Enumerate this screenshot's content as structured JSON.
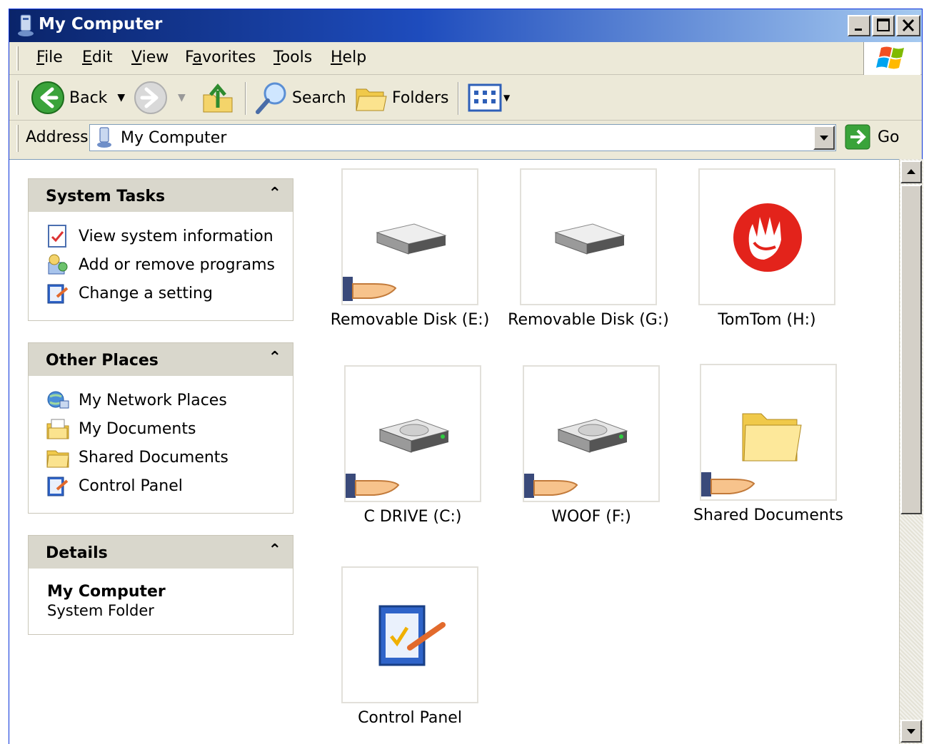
{
  "window": {
    "title": "My Computer"
  },
  "menu": {
    "items": [
      {
        "label": "File",
        "accel": "F",
        "rest": "ile"
      },
      {
        "label": "Edit",
        "accel": "E",
        "rest": "dit"
      },
      {
        "label": "View",
        "accel": "V",
        "rest": "iew"
      },
      {
        "label": "Favorites",
        "pre": "F",
        "accel": "a",
        "rest": "vorites"
      },
      {
        "label": "Tools",
        "accel": "T",
        "rest": "ools"
      },
      {
        "label": "Help",
        "accel": "H",
        "rest": "elp"
      }
    ]
  },
  "toolbar": {
    "back_label": "Back",
    "search_label": "Search",
    "folders_label": "Folders"
  },
  "address": {
    "label": "Address",
    "value": "My Computer",
    "go_label": "Go"
  },
  "panes": {
    "system_tasks": {
      "title": "System Tasks",
      "items": [
        "View system information",
        "Add or remove programs",
        "Change a setting"
      ]
    },
    "other_places": {
      "title": "Other Places",
      "items": [
        "My Network Places",
        "My Documents",
        "Shared Documents",
        "Control Panel"
      ]
    },
    "details": {
      "title": "Details",
      "name": "My Computer",
      "type": "System Folder"
    }
  },
  "items": [
    {
      "label": "Removable Disk (E:)",
      "icon": "removable-disk-icon",
      "shared": true
    },
    {
      "label": "Removable Disk (G:)",
      "icon": "removable-disk-icon",
      "shared": false
    },
    {
      "label": "TomTom (H:)",
      "icon": "tomtom-icon",
      "shared": false
    },
    {
      "label": "C DRIVE (C:)",
      "icon": "hard-drive-icon",
      "shared": true
    },
    {
      "label": "WOOF (F:)",
      "icon": "hard-drive-icon",
      "shared": true
    },
    {
      "label": "Shared Documents",
      "icon": "folder-icon",
      "shared": true
    },
    {
      "label": "Control Panel",
      "icon": "control-panel-icon",
      "shared": false
    }
  ],
  "colors": {
    "titlebar": "#0a246a",
    "pane_header": "#d9d7cc",
    "chrome": "#ece9d8"
  }
}
